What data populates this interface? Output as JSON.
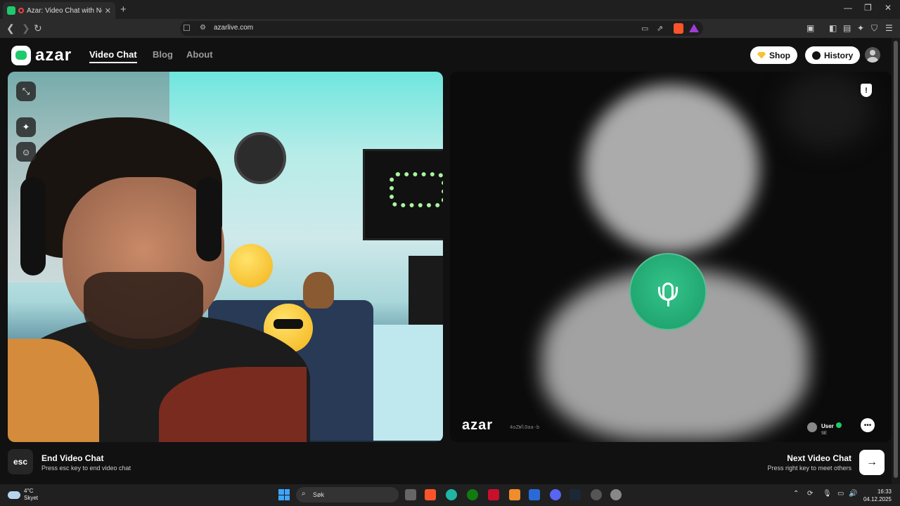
{
  "browser": {
    "tab_title": "Azar: Video Chat with New Pe",
    "url": "azarlive.com"
  },
  "site": {
    "logo_text": "azar",
    "nav": [
      {
        "label": "Video Chat",
        "active": true
      },
      {
        "label": "Blog",
        "active": false
      },
      {
        "label": "About",
        "active": false
      }
    ],
    "shop_label": "Shop",
    "history_label": "History"
  },
  "remote": {
    "watermark": "azar",
    "session_id": "4oZWlOaa-b",
    "user_name": "User",
    "user_country": "SE"
  },
  "controls": {
    "esc_key": "esc",
    "end_title": "End Video Chat",
    "end_hint": "Press esc key to end video chat",
    "next_title": "Next Video Chat",
    "next_hint": "Press right key to meet others"
  },
  "taskbar": {
    "temperature": "4°C",
    "condition": "Skyet",
    "search_placeholder": "Søk",
    "time": "16:33",
    "date": "04.12.2025"
  },
  "colors": {
    "accent_green": "#1fc96d",
    "page_bg": "#111111",
    "shop_gem": "#f6c431"
  }
}
